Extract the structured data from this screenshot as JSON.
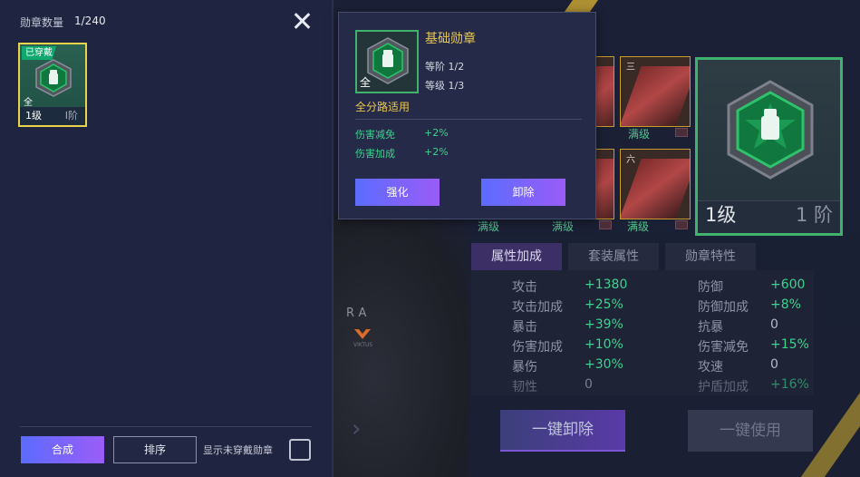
{
  "left_panel": {
    "title": "勋章数量",
    "count": "1/240",
    "medal": {
      "worn_badge": "已穿戴",
      "route_tag": "全",
      "level": "1级",
      "tier": "I阶"
    },
    "buttons": {
      "compose": "合成",
      "sort": "排序"
    },
    "show_unworn_label": "显示未穿戴勋章"
  },
  "popup": {
    "name": "基础勋章",
    "route_tag": "全",
    "tier": "等阶 1/2",
    "level": "等级 1/3",
    "route": "全分路适用",
    "stats": [
      {
        "name": "伤害减免",
        "value": "+2%"
      },
      {
        "name": "伤害加成",
        "value": "+2%"
      }
    ],
    "buttons": {
      "enhance": "强化",
      "unequip": "卸除"
    }
  },
  "grid": {
    "cells": [
      {
        "num": "三",
        "label": "满级"
      },
      {
        "num": "六",
        "label": "满级"
      }
    ],
    "bottom_labels": [
      "满级",
      "满级",
      "满级",
      "满级"
    ]
  },
  "big_medal": {
    "level": "1级",
    "tier": "1 阶"
  },
  "attr_tabs": [
    "属性加成",
    "套装属性",
    "勋章特性"
  ],
  "attributes_left": [
    {
      "name": "攻击",
      "value": "+1380"
    },
    {
      "name": "攻击加成",
      "value": "+25%"
    },
    {
      "name": "暴击",
      "value": "+39%"
    },
    {
      "name": "伤害加成",
      "value": "+10%"
    },
    {
      "name": "暴伤",
      "value": "+30%"
    },
    {
      "name": "韧性",
      "value": "0"
    }
  ],
  "attributes_right": [
    {
      "name": "防御",
      "value": "+600"
    },
    {
      "name": "防御加成",
      "value": "+8%"
    },
    {
      "name": "抗暴",
      "value": "0"
    },
    {
      "name": "伤害减免",
      "value": "+15%"
    },
    {
      "name": "攻速",
      "value": "0"
    },
    {
      "name": "护盾加成",
      "value": "+16%"
    }
  ],
  "actions": {
    "unequip_all": "一键卸除",
    "use_all": "一键使用"
  },
  "player": {
    "jersey_text": "RA",
    "logo_text": "VIKTUS"
  },
  "colors": {
    "accent_green": "#3ed28e",
    "gold": "#e9c84f",
    "button_gradient_start": "#5c6cff",
    "button_gradient_end": "#9a5cf7"
  }
}
